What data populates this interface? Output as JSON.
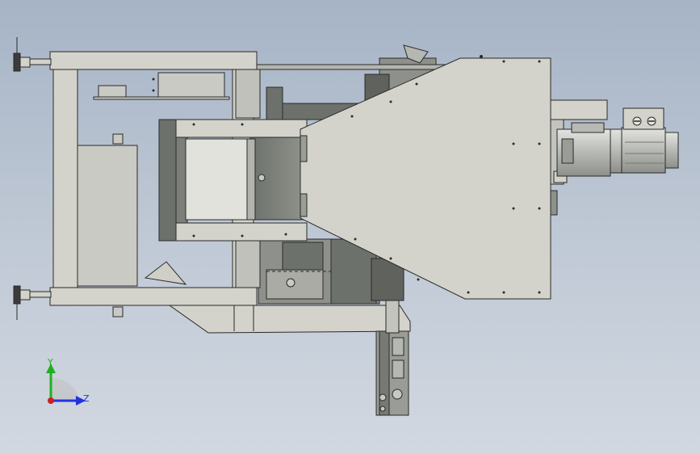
{
  "viewport": {
    "background_top": "#a6b4c6",
    "background_bottom": "#d2d8e1"
  },
  "colors": {
    "part_fill": "#d3d3cb",
    "part_stroke": "#2a2a2a",
    "dark_part": "#7c7f79",
    "mid_part": "#a9aba4",
    "motor": "#c8c9c4",
    "axis_x": "#cc2020",
    "axis_y": "#1fb01f",
    "axis_z": "#2233dd"
  },
  "triad": {
    "y_label": "Y",
    "z_label": "Z"
  },
  "icons": {
    "motor_terminal": "motor-terminal-icon",
    "leveling_foot": "leveling-foot-icon"
  }
}
